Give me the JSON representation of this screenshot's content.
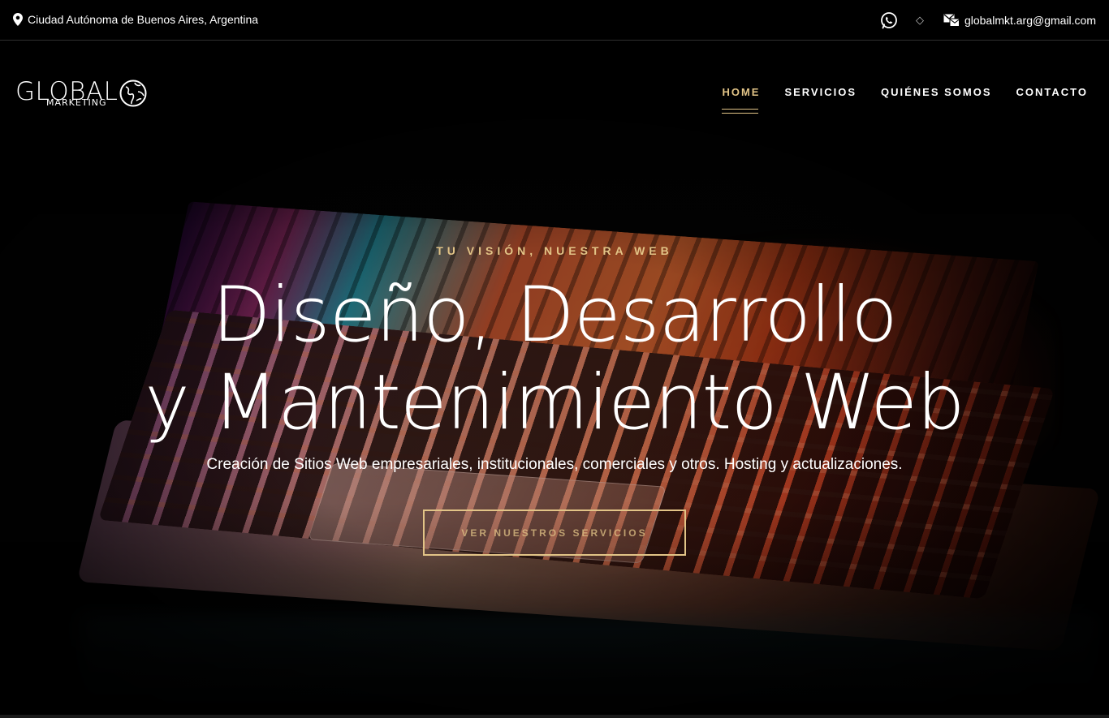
{
  "topbar": {
    "location_icon": "map-pin-icon",
    "location": "Ciudad Autónoma de Buenos Aires, Argentina",
    "whatsapp_icon": "whatsapp-icon",
    "separator": "◇",
    "mail_icon": "mail-icon",
    "email": "globalmkt.arg@gmail.com"
  },
  "header": {
    "logo_main": "GLOBAL",
    "logo_sub": "MARKETING",
    "logo_icon": "globe-icon",
    "nav": [
      {
        "label": "HOME",
        "active": true
      },
      {
        "label": "SERVICIOS",
        "active": false
      },
      {
        "label": "QUIÉNES SOMOS",
        "active": false
      },
      {
        "label": "CONTACTO",
        "active": false
      }
    ]
  },
  "hero": {
    "eyebrow": "TU VISIÓN, NUESTRA WEB",
    "headline_line1": "Diseño, Desarrollo",
    "headline_line2": "y Mantenimiento Web",
    "subtext": "Creación de Sitios Web empresariales, institucionales, comerciales y otros. Hosting y actualizaciones.",
    "cta_label": "VER NUESTROS SERVICIOS"
  },
  "colors": {
    "accent": "#e2c487",
    "background": "#030303",
    "text": "#ffffff"
  }
}
